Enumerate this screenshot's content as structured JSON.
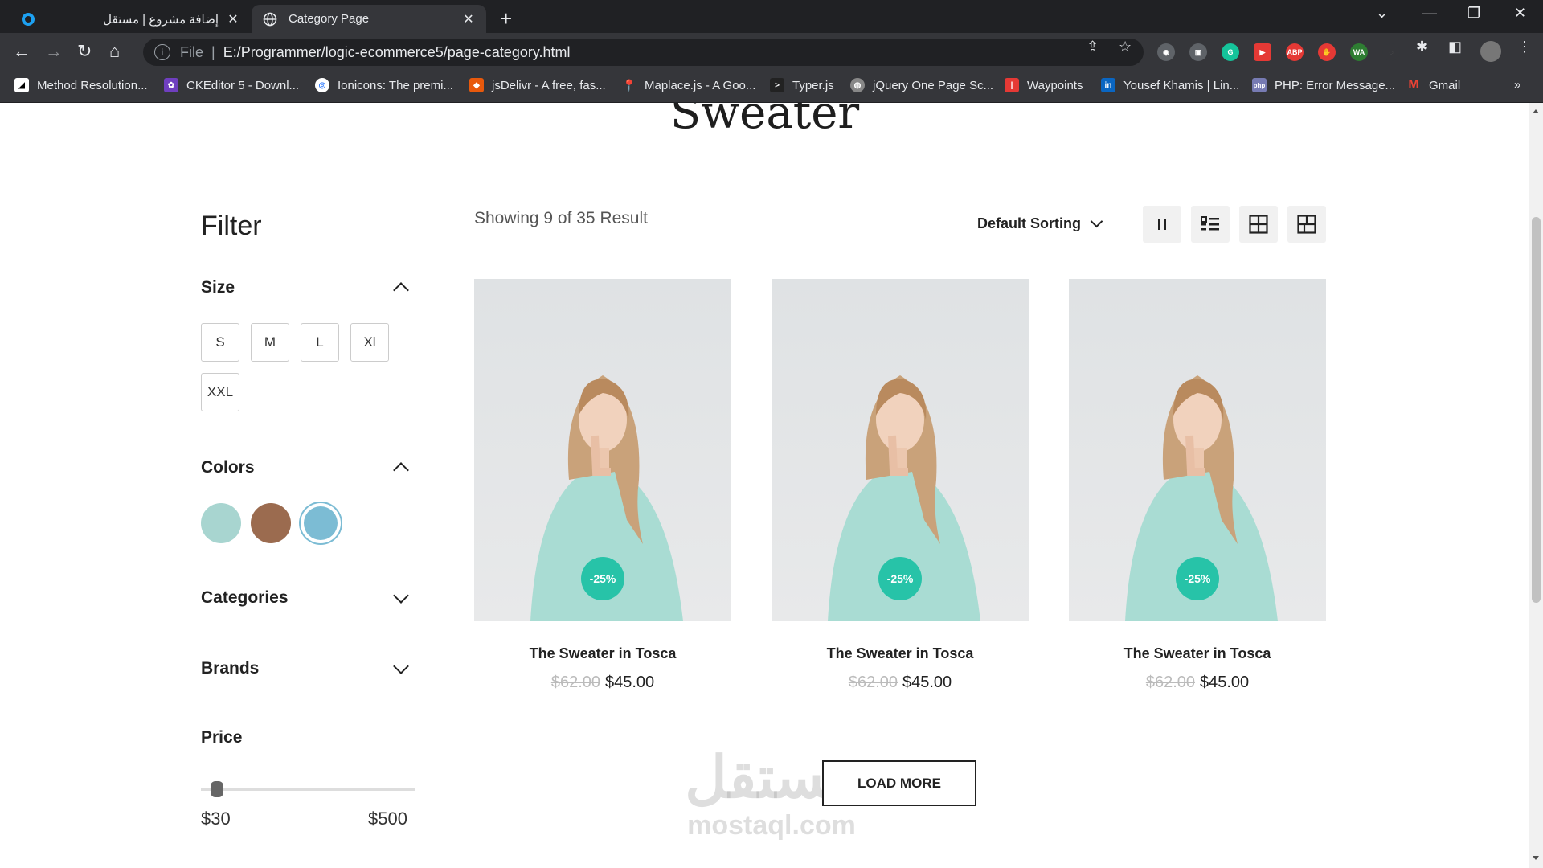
{
  "browser": {
    "tabs": [
      {
        "title": "إضافة مشروع | مستقل",
        "active": false
      },
      {
        "title": "Category Page",
        "active": true
      }
    ],
    "address": {
      "scheme": "File",
      "url": "E:/Programmer/logic-ecommerce5/page-category.html"
    },
    "bookmarks": [
      "Method Resolution...",
      "CKEditor 5 - Downl...",
      "Ionicons: The premi...",
      "jsDelivr - A free, fas...",
      "Maplace.js - A Goo...",
      "Typer.js",
      "jQuery One Page Sc...",
      "Waypoints",
      "Yousef Khamis | Lin...",
      "PHP: Error Message...",
      "Gmail"
    ],
    "extensions": [
      "ABP",
      "WA"
    ]
  },
  "page": {
    "title": "Sweater",
    "filter": {
      "title": "Filter",
      "size_label": "Size",
      "sizes": [
        "S",
        "M",
        "L",
        "Xl",
        "XXL"
      ],
      "colors_label": "Colors",
      "colors": [
        "#a8d5d0",
        "#9b6b4f",
        "#7cbcd4"
      ],
      "categories_label": "Categories",
      "brands_label": "Brands",
      "price_label": "Price",
      "price_min": "$30",
      "price_max": "$500"
    },
    "showing": "Showing 9 of 35 Result",
    "sorting": "Default Sorting",
    "view_modes": [
      "columns-2-icon",
      "list-icon",
      "grid-4-icon",
      "grid-large-icon"
    ],
    "products": [
      {
        "name": "The Sweater in Tosca",
        "old_price": "$62.00",
        "price": "$45.00",
        "discount": "-25%"
      },
      {
        "name": "The Sweater in Tosca",
        "old_price": "$62.00",
        "price": "$45.00",
        "discount": "-25%"
      },
      {
        "name": "The Sweater in Tosca",
        "old_price": "$62.00",
        "price": "$45.00",
        "discount": "-25%"
      }
    ],
    "load_more": "LOAD MORE",
    "watermark": {
      "arabic": "مستقل",
      "latin": "mostaql.com"
    }
  }
}
